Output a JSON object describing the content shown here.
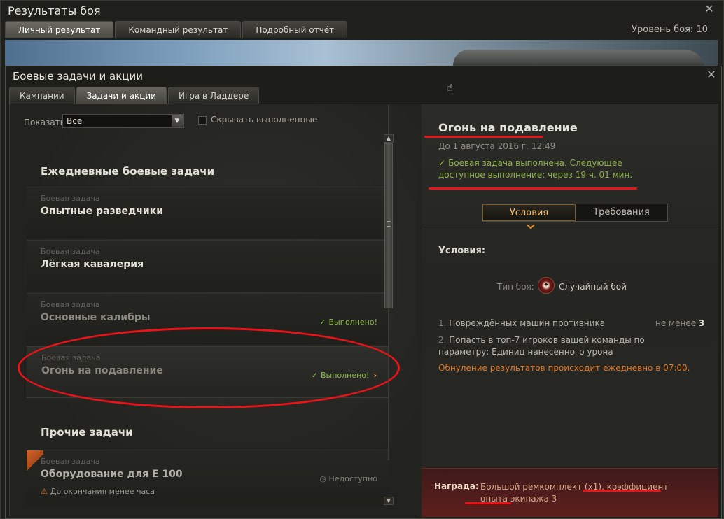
{
  "outer": {
    "title": "Результаты боя",
    "tabs": [
      "Личный результат",
      "Командный результат",
      "Подробный отчёт"
    ],
    "level": "Уровень боя: 10"
  },
  "dialog": {
    "title": "Боевые задачи и акции",
    "tabs": [
      "Кампании",
      "Задачи и акции",
      "Игра в Ладдере"
    ]
  },
  "filter": {
    "label": "Показать:",
    "selected": "Все",
    "hide_done_label": "Скрывать выполненные"
  },
  "sections": {
    "daily": "Ежедневные боевые задачи",
    "other": "Прочие задачи"
  },
  "cards": [
    {
      "kind": "Боевая задача",
      "name": "Опытные разведчики",
      "status": ""
    },
    {
      "kind": "Боевая задача",
      "name": "Лёгкая кавалерия",
      "status": ""
    },
    {
      "kind": "Боевая задача",
      "name": "Основные калибры",
      "status": "Выполнено!"
    },
    {
      "kind": "Боевая задача",
      "name": "Огонь на подавление",
      "status": "Выполнено!"
    },
    {
      "kind": "Боевая задача",
      "name": "Оборудование для Е 100",
      "status": "Недоступно",
      "warning": "До окончания менее часа"
    }
  ],
  "quest": {
    "title": "Огонь на подавление",
    "date": "До 1 августа 2016 г. 12:49",
    "done_text": "Боевая задача выполнена. Следующее доступное выполнение: через 19 ч. 01 мин.",
    "seg_conditions": "Условия",
    "seg_requirements": "Требования",
    "conditions_title": "Условия:",
    "battle_type_label": "Тип боя:",
    "battle_type": "Случайный бой",
    "cond1_num": "1.",
    "cond1_text": "Повреждённых машин противника",
    "cond1_min": "не менее",
    "cond1_value": "3",
    "cond2_num": "2.",
    "cond2_text": "Попасть в топ-7 игроков вашей команды по параметру: Единиц нанесённого урона",
    "reset_note": "Обнуление результатов происходит ежедневно в 07:00.",
    "reward_label": "Награда:",
    "reward_text": "Большой ремкомплект (x1), коэффициент опыта экипажа 3"
  },
  "colors": {
    "accent_orange": "#e0761f",
    "done_green": "#8db14a",
    "annotation_red": "#e8141a"
  }
}
